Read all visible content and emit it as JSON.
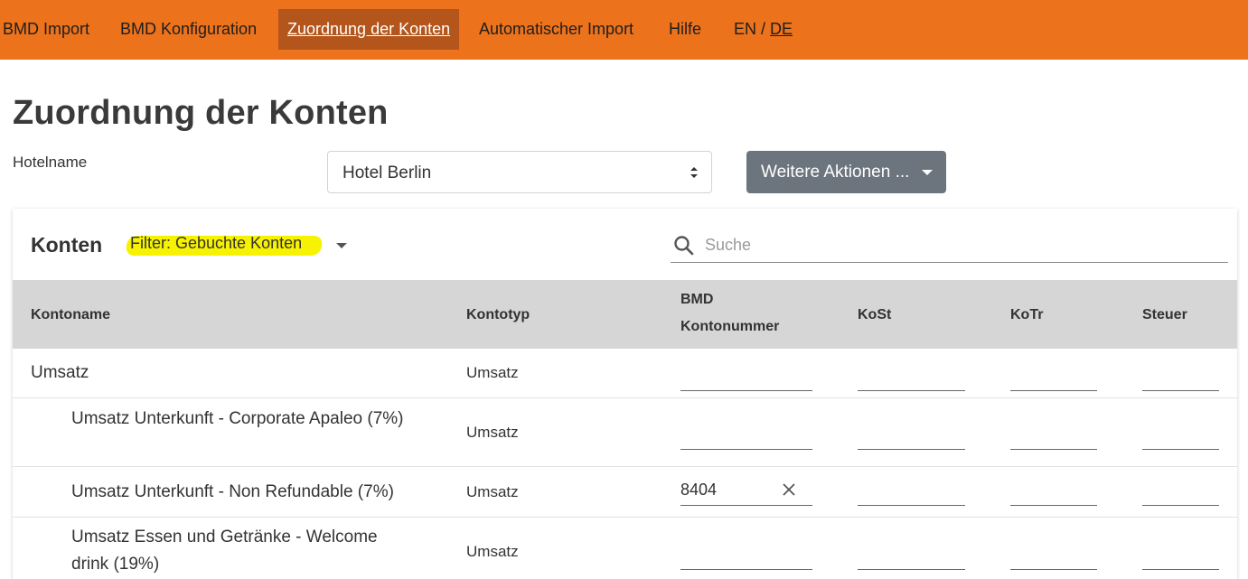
{
  "nav": {
    "items": [
      "BMD Import",
      "BMD Konfiguration",
      "Zuordnung der Konten",
      "Automatischer Import",
      "Hilfe"
    ],
    "lang_en": "EN",
    "lang_sep": " / ",
    "lang_de": "DE"
  },
  "page": {
    "title": "Zuordnung der Konten",
    "hotel_label": "Hotelname",
    "hotel_value": "Hotel Berlin",
    "actions_label": "Weitere Aktionen ..."
  },
  "card": {
    "title": "Konten",
    "filter": "Filter: Gebuchte Konten",
    "search_placeholder": "Suche"
  },
  "table": {
    "headers": {
      "name": "Kontoname",
      "type": "Kontotyp",
      "bmd_line1": "BMD",
      "bmd_line2": "Kontonummer",
      "kost": "KoSt",
      "kotr": "KoTr",
      "steuer": "Steuer"
    },
    "rows": [
      {
        "name": "Umsatz",
        "type": "Umsatz",
        "bmd": ""
      },
      {
        "name": "Umsatz Unterkunft - Corporate Apaleo (7%)",
        "type": "Umsatz",
        "bmd": ""
      },
      {
        "name": "Umsatz Unterkunft - Non Refundable (7%)",
        "type": "Umsatz",
        "bmd": "8404"
      },
      {
        "name": "Umsatz Essen und Getränke - Welcome drink (19%)",
        "type": "Umsatz",
        "bmd": ""
      }
    ]
  },
  "colors": {
    "nav_bg": "#ec721c",
    "nav_active": "#b4551b",
    "button_gray": "#6c757d",
    "header_gray": "#d6d6d6",
    "highlight": "#f7f200"
  }
}
